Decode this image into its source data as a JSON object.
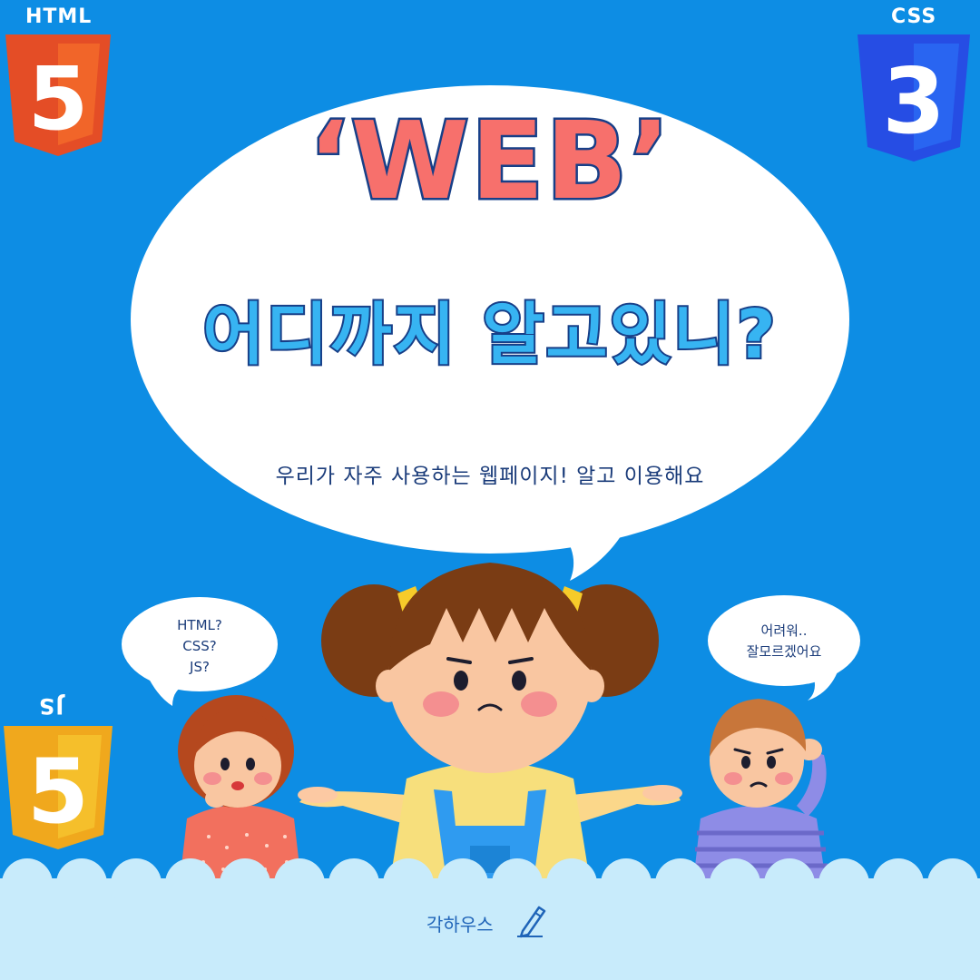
{
  "logos": {
    "html": {
      "label": "HTML",
      "glyph": "5",
      "color": "#e44d26"
    },
    "css": {
      "label": "CSS",
      "glyph": "3",
      "color": "#264de4"
    },
    "js": {
      "label": "JS",
      "glyph": "5",
      "color": "#f0a81d"
    }
  },
  "main_bubble": {
    "title": "‘WEB’",
    "subtitle": "어디까지 알고있니?",
    "caption": "우리가 자주 사용하는 웹페이지! 알고 이용해요"
  },
  "left_bubble": {
    "lines": [
      "HTML?",
      "CSS?",
      "JS?"
    ]
  },
  "right_bubble": {
    "lines": [
      "어려워..",
      "잘모르겠어요"
    ]
  },
  "footer": {
    "brand": "각하우스",
    "icon": "pencil-icon"
  },
  "colors": {
    "background": "#0d8de4",
    "title": "#f7706c",
    "subtitle": "#37b4f2",
    "outline": "#173f88",
    "footer_band": "#c8ebfb"
  }
}
